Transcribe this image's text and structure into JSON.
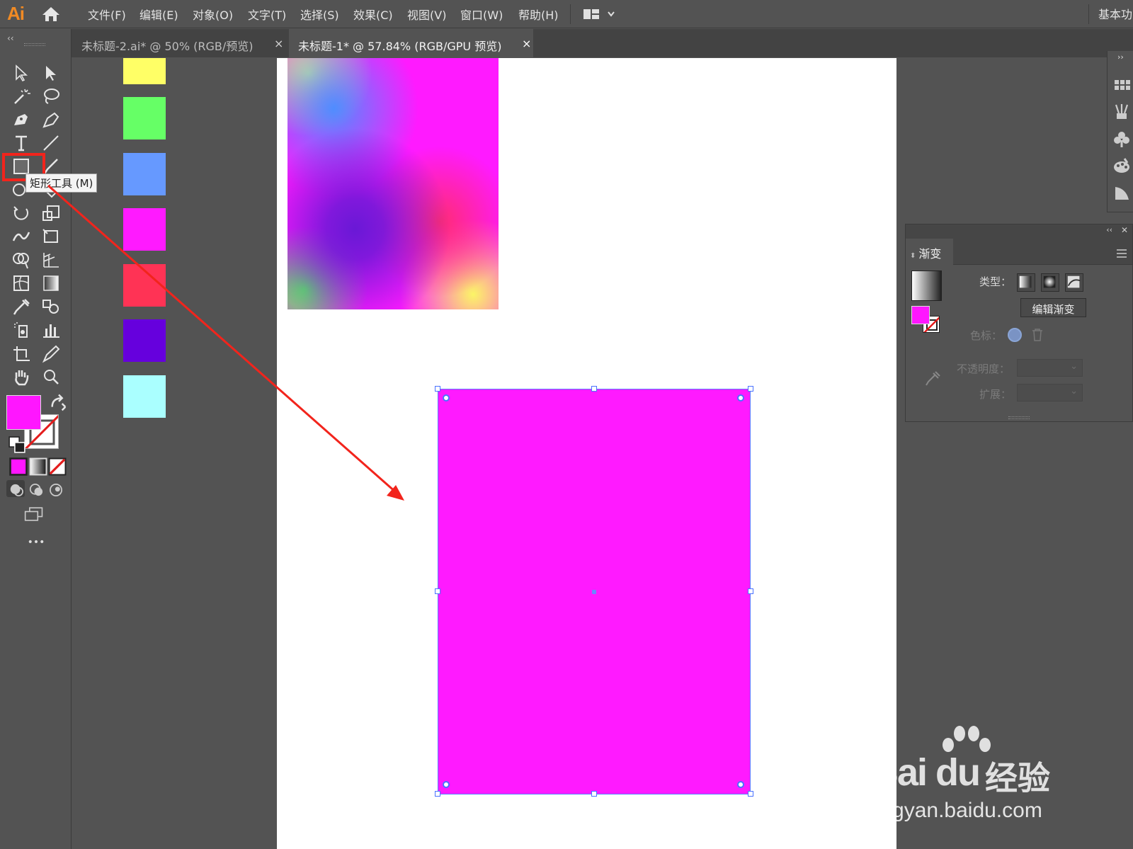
{
  "app": {
    "logo": "Ai",
    "workspace": "基本功"
  },
  "menu": [
    {
      "label": "文件(F)"
    },
    {
      "label": "编辑(E)"
    },
    {
      "label": "对象(O)"
    },
    {
      "label": "文字(T)"
    },
    {
      "label": "选择(S)"
    },
    {
      "label": "效果(C)"
    },
    {
      "label": "视图(V)"
    },
    {
      "label": "窗口(W)"
    },
    {
      "label": "帮助(H)"
    }
  ],
  "tabs": [
    {
      "label": "未标题-2.ai* @ 50% (RGB/预览)",
      "close": "×",
      "active": false
    },
    {
      "label": "未标题-1* @ 57.84% (RGB/GPU 预览)",
      "close": "×",
      "active": true
    }
  ],
  "toolbar": {
    "collapse": "‹‹",
    "tooltip": "矩形工具 (M)",
    "more": "•••",
    "fill_color": "#ff16ff"
  },
  "swatches": [
    {
      "color": "#ffff66"
    },
    {
      "color": "#66ff66"
    },
    {
      "color": "#6699ff"
    },
    {
      "color": "#ff1aff"
    },
    {
      "color": "#ff3355"
    },
    {
      "color": "#6600dd"
    },
    {
      "color": "#aaffff"
    }
  ],
  "selection": {
    "fill": "#ff1aff"
  },
  "gradient_panel": {
    "title": "渐变",
    "collapse": "‹‹",
    "close": "✕",
    "type_label": "类型：",
    "edit_button": "编辑渐变",
    "stop_label": "色标：",
    "opacity_label": "不透明度：",
    "location_label": "扩展：",
    "fill_color": "#ff16ff"
  },
  "right_strip": {
    "expand": "››"
  },
  "watermark": {
    "logo": "Bai du",
    "brand": "经验",
    "url": "jingyan.baidu.com"
  },
  "annotation_color": "#f2241c"
}
